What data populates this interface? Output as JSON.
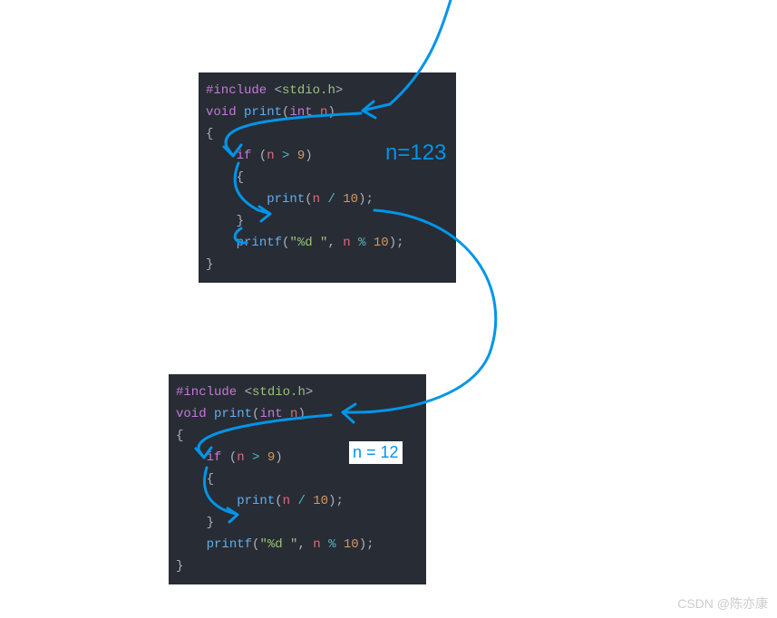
{
  "code1": {
    "include_keyword": "#include",
    "include_open": " <",
    "include_path": "stdio.h",
    "include_close": ">",
    "void": "void",
    "funcname": "print",
    "open_paren": "(",
    "int": "int",
    "param": " n",
    "close_paren": ")",
    "open_brace": "{",
    "indent1": "    ",
    "if": "if",
    "cond_open": " (",
    "cond_var": "n",
    "cond_op": " > ",
    "cond_num": "9",
    "cond_close": ")",
    "inner_open": "    {",
    "indent2": "        ",
    "call_name": "print",
    "call_open": "(",
    "call_var": "n",
    "call_op": " / ",
    "call_num": "10",
    "call_close": ");",
    "inner_close": "    }",
    "printf_name": "printf",
    "printf_open": "(",
    "printf_str": "\"%d \"",
    "printf_comma": ", ",
    "printf_var": "n",
    "printf_op": " % ",
    "printf_num": "10",
    "printf_close": ");",
    "close_brace": "}"
  },
  "annotations": {
    "n1": "n=123",
    "n2": "n = 12"
  },
  "watermark": "CSDN @陈亦康"
}
